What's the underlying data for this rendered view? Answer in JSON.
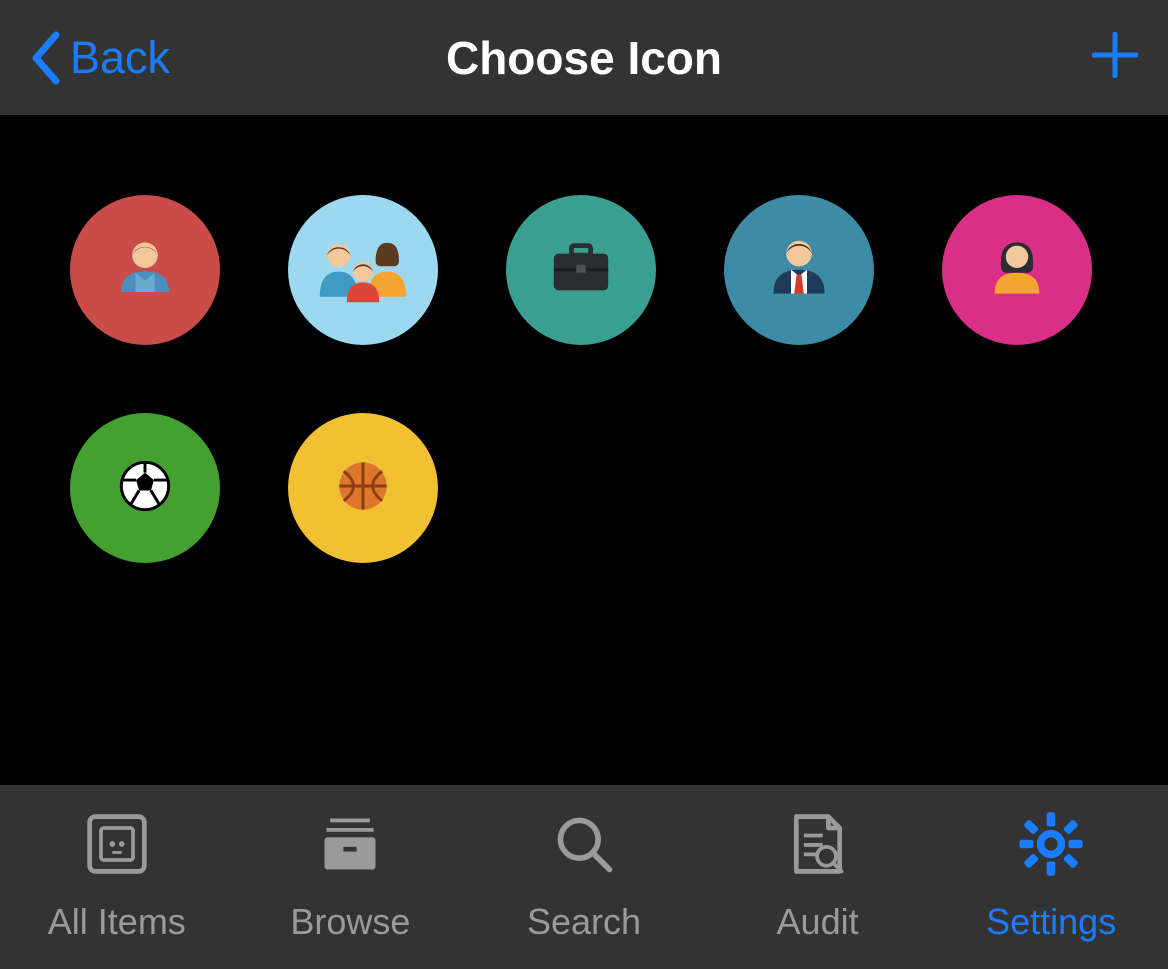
{
  "nav": {
    "back_label": "Back",
    "title": "Choose Icon",
    "add_label": "Add"
  },
  "icons": [
    {
      "name": "person-red",
      "bg": "ic-red",
      "glyph": "user-single"
    },
    {
      "name": "family",
      "bg": "ic-lightblue",
      "glyph": "user-family"
    },
    {
      "name": "briefcase",
      "bg": "ic-teal",
      "glyph": "briefcase"
    },
    {
      "name": "businessman",
      "bg": "ic-slateblue",
      "glyph": "user-tie"
    },
    {
      "name": "woman",
      "bg": "ic-pink",
      "glyph": "user-female"
    },
    {
      "name": "soccer",
      "bg": "ic-green",
      "glyph": "soccer-ball"
    },
    {
      "name": "basketball",
      "bg": "ic-yellow",
      "glyph": "basketball"
    }
  ],
  "tabs": [
    {
      "label": "All Items",
      "icon": "safe-icon",
      "active": false
    },
    {
      "label": "Browse",
      "icon": "browse-icon",
      "active": false
    },
    {
      "label": "Search",
      "icon": "search-icon",
      "active": false
    },
    {
      "label": "Audit",
      "icon": "audit-icon",
      "active": false
    },
    {
      "label": "Settings",
      "icon": "gear-icon",
      "active": true
    }
  ],
  "colors": {
    "accent": "#1a7dff",
    "bar": "#333333",
    "inactive": "#9a9a9a"
  }
}
